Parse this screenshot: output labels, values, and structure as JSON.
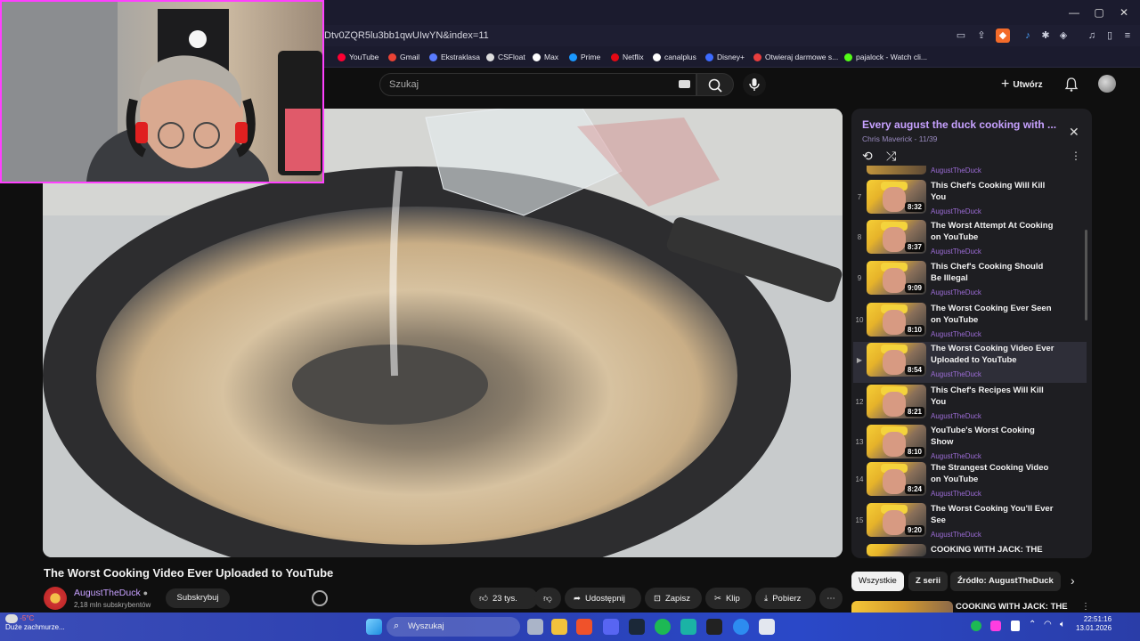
{
  "browser": {
    "url": "Dtv0ZQR5lu3bb1qwUIwYN&index=11",
    "bookmarks": [
      "YouTube",
      "Gmail",
      "Ekstraklasa",
      "CSFloat",
      "Max",
      "Prime",
      "Netflix",
      "canalplus",
      "Disney+",
      "Otwieraj darmowe s...",
      "pajalock - Watch cli..."
    ],
    "bookmark_colors": [
      "#ff0033",
      "#ea4335",
      "#5a7cff",
      "#dddddd",
      "#ffffff",
      "#1a98ff",
      "#e50914",
      "#ffffff",
      "#3d6bff",
      "#e83e3e",
      "#53fc18"
    ]
  },
  "header": {
    "search_placeholder": "Szukaj",
    "create_label": "Utwórz"
  },
  "video": {
    "title": "The Worst Cooking Video Ever Uploaded to YouTube",
    "channel": "AugustTheDuck",
    "subscribers": "2,18 mln subskrybentów",
    "subscribe_label": "Subskrybuj",
    "likes": "23 tys.",
    "share_label": "Udostępnij",
    "save_label": "Zapisz",
    "clip_label": "Klip",
    "download_label": "Pobierz"
  },
  "playlist": {
    "title": "Every august the duck cooking with ...",
    "meta": "Chris Maverick - 11/39",
    "top_channel": "AugustTheDuck",
    "items": [
      {
        "num": "7",
        "title": "This Chef's Cooking Will Kill You",
        "channel": "AugustTheDuck",
        "duration": "8:32"
      },
      {
        "num": "8",
        "title": "The Worst Attempt At Cooking on YouTube",
        "channel": "AugustTheDuck",
        "duration": "8:37"
      },
      {
        "num": "9",
        "title": "This Chef's Cooking Should Be Illegal",
        "channel": "AugustTheDuck",
        "duration": "9:09"
      },
      {
        "num": "10",
        "title": "The Worst Cooking Ever Seen on YouTube",
        "channel": "AugustTheDuck",
        "duration": "8:10"
      },
      {
        "num": "▶",
        "title": "The Worst Cooking Video Ever Uploaded to YouTube",
        "channel": "AugustTheDuck",
        "duration": "8:54"
      },
      {
        "num": "12",
        "title": "This Chef's Recipes Will Kill You",
        "channel": "AugustTheDuck",
        "duration": "8:21"
      },
      {
        "num": "13",
        "title": "YouTube's Worst Cooking Show",
        "channel": "AugustTheDuck",
        "duration": "8:10"
      },
      {
        "num": "14",
        "title": "The Strangest Cooking Video on YouTube",
        "channel": "AugustTheDuck",
        "duration": "8:24"
      },
      {
        "num": "15",
        "title": "The Worst Cooking You'll Ever See",
        "channel": "AugustTheDuck",
        "duration": "9:20"
      },
      {
        "num": "",
        "title": "COOKING WITH JACK: THE",
        "channel": "",
        "duration": ""
      }
    ]
  },
  "chips": [
    "Wszystkie",
    "Z serii",
    "Źródło: AugustTheDuck"
  ],
  "next_video_title": "COOKING WITH JACK: THE",
  "taskbar": {
    "search_label": "Wyszukaj",
    "weather_temp": "-5°C",
    "weather_desc": "Duże zachmurze...",
    "time": "22:51:16",
    "date": "13.01.2026"
  }
}
